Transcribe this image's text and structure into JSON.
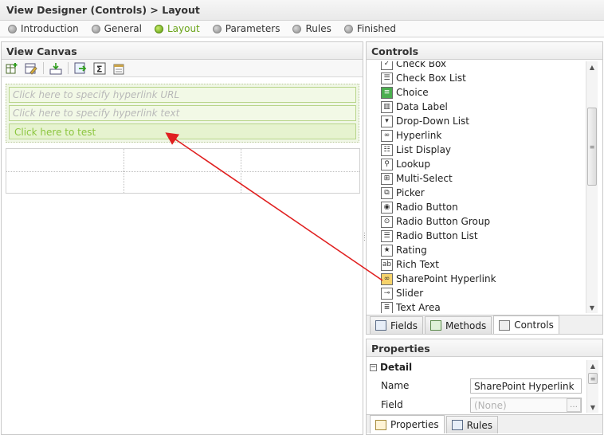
{
  "title": "View Designer (Controls) > Layout",
  "wizard_steps": [
    "Introduction",
    "General",
    "Layout",
    "Parameters",
    "Rules",
    "Finished"
  ],
  "active_step": "Layout",
  "canvas": {
    "header": "View Canvas",
    "hyperlink_url_placeholder": "Click here to specify hyperlink URL",
    "hyperlink_text_placeholder": "Click here to specify hyperlink text",
    "test_link": "Click here to test"
  },
  "controls": {
    "header": "Controls",
    "items": [
      "Check Box",
      "Check Box List",
      "Choice",
      "Data Label",
      "Drop-Down List",
      "Hyperlink",
      "List Display",
      "Lookup",
      "Multi-Select",
      "Picker",
      "Radio Button",
      "Radio Button Group",
      "Radio Button List",
      "Rating",
      "Rich Text",
      "SharePoint Hyperlink",
      "Slider",
      "Text Area"
    ],
    "tabs": [
      "Fields",
      "Methods",
      "Controls"
    ],
    "selected_tab": "Controls"
  },
  "properties": {
    "header": "Properties",
    "section": "Detail",
    "rows": [
      {
        "label": "Name",
        "value": "SharePoint Hyperlink"
      },
      {
        "label": "Field",
        "value": "(None)"
      }
    ],
    "tabs": [
      "Properties",
      "Rules"
    ]
  },
  "colors": {
    "accent_green": "#8cc63f",
    "arrow_red": "#e02020"
  }
}
